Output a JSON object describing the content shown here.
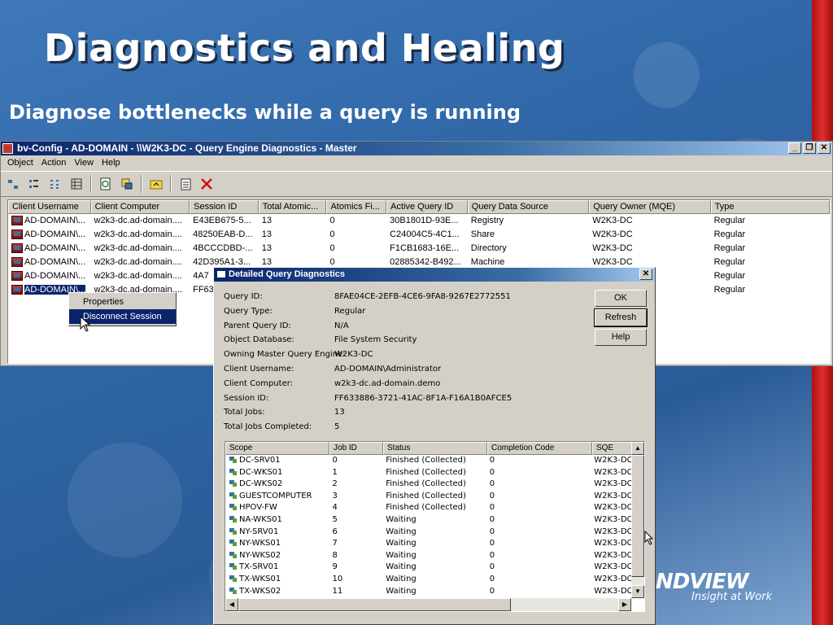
{
  "slide": {
    "title": "Diagnostics and Healing",
    "subtitle": "Diagnose bottlenecks while a query is running",
    "logo_main": "NDVIEW",
    "logo_sub": "Insight at Work"
  },
  "window": {
    "title": "bv-Config - AD-DOMAIN - \\\\W2K3-DC - Query Engine Diagnostics - Master",
    "menu": [
      "Object",
      "Action",
      "View",
      "Help"
    ]
  },
  "list": {
    "columns": [
      "Client Username",
      "Client Computer",
      "Session ID",
      "Total Atomic...",
      "Atomics Fi...",
      "Active Query ID",
      "Query Data Source",
      "Query Owner (MQE)",
      "Type"
    ],
    "rows": [
      [
        "AD-DOMAIN\\...",
        "w2k3-dc.ad-domain....",
        "E43EB675-5...",
        "13",
        "0",
        "30B1801D-93E...",
        "Registry",
        "W2K3-DC",
        "Regular"
      ],
      [
        "AD-DOMAIN\\...",
        "w2k3-dc.ad-domain....",
        "48250EAB-D...",
        "13",
        "0",
        "C24004C5-4C1...",
        "Share",
        "W2K3-DC",
        "Regular"
      ],
      [
        "AD-DOMAIN\\...",
        "w2k3-dc.ad-domain....",
        "4BCCCDBD-...",
        "13",
        "0",
        "F1CB1683-16E...",
        "Directory",
        "W2K3-DC",
        "Regular"
      ],
      [
        "AD-DOMAIN\\...",
        "w2k3-dc.ad-domain....",
        "42D395A1-3...",
        "13",
        "0",
        "02885342-B492...",
        "Machine",
        "W2K3-DC",
        "Regular"
      ],
      [
        "AD-DOMAIN\\...",
        "w2k3-dc.ad-domain....",
        "4A7",
        "",
        "",
        "",
        "",
        "",
        "Regular"
      ],
      [
        "AD-DOMAIN\\...",
        "w2k3-dc.ad-domain....",
        "FF63",
        "",
        "",
        "",
        "",
        "",
        "Regular"
      ]
    ]
  },
  "context_menu": {
    "items": [
      "Properties",
      "Disconnect Session"
    ]
  },
  "dialog": {
    "title": "Detailed Query Diagnostics",
    "fields": [
      {
        "label": "Query ID:",
        "value": "8FAE04CE-2EFB-4CE6-9FA8-9267E2772551"
      },
      {
        "label": "Query Type:",
        "value": "Regular"
      },
      {
        "label": "Parent Query ID:",
        "value": "N/A"
      },
      {
        "label": "Object Database:",
        "value": "File System Security"
      },
      {
        "label": "Owning Master Query Engine:",
        "value": "W2K3-DC"
      },
      {
        "label": "Client Username:",
        "value": "AD-DOMAIN\\Administrator"
      },
      {
        "label": "Client Computer:",
        "value": "w2k3-dc.ad-domain.demo"
      },
      {
        "label": "Session ID:",
        "value": "FF633886-3721-41AC-8F1A-F16A1B0AFCE5"
      },
      {
        "label": "Total Jobs:",
        "value": "13"
      },
      {
        "label": "Total Jobs Completed:",
        "value": "5"
      }
    ],
    "buttons": [
      "OK",
      "Refresh",
      "Help"
    ],
    "jobs_columns": [
      "Scope",
      "Job ID",
      "Status",
      "Completion Code",
      "SQE"
    ],
    "jobs": [
      [
        "DC-SRV01",
        "0",
        "Finished (Collected)",
        "0",
        "W2K3-DC"
      ],
      [
        "DC-WKS01",
        "1",
        "Finished (Collected)",
        "0",
        "W2K3-DC"
      ],
      [
        "DC-WKS02",
        "2",
        "Finished (Collected)",
        "0",
        "W2K3-DC"
      ],
      [
        "GUESTCOMPUTER",
        "3",
        "Finished (Collected)",
        "0",
        "W2K3-DC"
      ],
      [
        "HPOV-FW",
        "4",
        "Finished (Collected)",
        "0",
        "W2K3-DC"
      ],
      [
        "NA-WKS01",
        "5",
        "Waiting",
        "0",
        "W2K3-DC"
      ],
      [
        "NY-SRV01",
        "6",
        "Waiting",
        "0",
        "W2K3-DC"
      ],
      [
        "NY-WKS01",
        "7",
        "Waiting",
        "0",
        "W2K3-DC"
      ],
      [
        "NY-WKS02",
        "8",
        "Waiting",
        "0",
        "W2K3-DC"
      ],
      [
        "TX-SRV01",
        "9",
        "Waiting",
        "0",
        "W2K3-DC"
      ],
      [
        "TX-WKS01",
        "10",
        "Waiting",
        "0",
        "W2K3-DC"
      ],
      [
        "TX-WKS02",
        "11",
        "Waiting",
        "0",
        "W2K3-DC"
      ]
    ]
  },
  "colors": {
    "titlebar": "#0a246a",
    "selection": "#0a246a",
    "window_face": "#d4d0c8",
    "accent_red": "#e03030"
  }
}
